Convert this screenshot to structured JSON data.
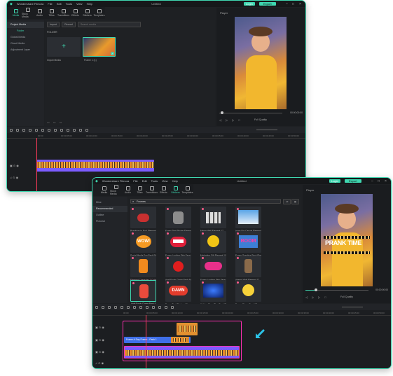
{
  "window1": {
    "app_name": "Wondershare Filmora",
    "menu": [
      "File",
      "Edit",
      "Tools",
      "View",
      "Help"
    ],
    "title": "Untitled",
    "login": "Login",
    "export": "Export",
    "tools": [
      "Media",
      "Stock Media",
      "Audio",
      "Titles",
      "Transitions",
      "Effects",
      "Stickers",
      "Templates"
    ],
    "sidebar": [
      "Project Media",
      "Folder",
      "Global Media",
      "Cloud Media",
      "Adjustment Layer"
    ],
    "import_btn": "Import",
    "record_btn": "Record",
    "search_placeholder": "Search media",
    "folder_label": "FOLDER",
    "import_media_label": "Import Media",
    "thumb_label": "Frame 1 (1)",
    "player_label": "Player",
    "time": "00:00:00:00",
    "quality": "Full Quality",
    "ruler": [
      "00:00",
      "00:00:05:00",
      "00:00:10:00",
      "00:00:15:00",
      "00:00:20:00",
      "00:00:25:00",
      "00:00:30:00",
      "00:00:35:00",
      "00:00:40:00",
      "00:00:45:00",
      "00:00:50:00"
    ]
  },
  "window2": {
    "app_name": "Wondershare Filmora",
    "menu": [
      "File",
      "Edit",
      "Tools",
      "View",
      "Help"
    ],
    "title": "Untitled",
    "login": "Login",
    "export": "Export",
    "tools": [
      "Media",
      "Stock Media",
      "Audio",
      "Titles",
      "Transitions",
      "Effects",
      "Stickers",
      "Templates"
    ],
    "sidebar": [
      "Mine",
      "Recommended",
      "Outline",
      "Pictorial"
    ],
    "search_value": "Frames",
    "player_label": "Player",
    "prank_text_1": "PRANK TIME",
    "time": "00:00:00:00",
    "quality": "Full Quality",
    "stickers": [
      {
        "caption": "Prankday in Fool Element 17",
        "art": "mouth"
      },
      {
        "caption": "Funny Text Sticker Element 5",
        "art": "cat"
      },
      {
        "caption": "Meme Wall Element 17",
        "art": "grid"
      },
      {
        "caption": "Icons For Casual Element 1",
        "art": "sky"
      },
      {
        "caption": "Social Media Fun Pack Elem...",
        "art": "wow"
      },
      {
        "caption": "Funny Looking Fish Face Ele...",
        "art": "teeth"
      },
      {
        "caption": "Marketing Gift Element 10",
        "art": "smiley"
      },
      {
        "caption": "Funny Graphics Pack Elem...",
        "art": "boom"
      },
      {
        "caption": "Element Character 2 Cubbe...",
        "art": "char"
      },
      {
        "caption": "April Fools Clown Pack Elem...",
        "art": "nose"
      },
      {
        "caption": "Funny Looking Fish Face Ele...",
        "art": "lips"
      },
      {
        "caption": "Absent Wolf Element 17",
        "art": "man"
      },
      {
        "caption": "April Fools Clown Pack Elem...",
        "art": "clown"
      },
      {
        "caption": "Funny Text Stickers Element...",
        "art": "damn"
      },
      {
        "caption": "Hidden Story Play Pack Ele...",
        "art": "curtain"
      },
      {
        "caption": "Funny Clown Emoji Element...",
        "art": "emoji"
      }
    ],
    "clip_label": "Frame A Day Frame - Pack 1",
    "ruler": [
      "00:00",
      "00:00:05:00",
      "00:00:10:00",
      "00:00:15:00",
      "00:00:20:00",
      "00:00:25:00",
      "00:00:30:00",
      "00:00:35:00",
      "00:00:40:00",
      "00:00:45:00",
      "00:00:50:00"
    ]
  },
  "colors": {
    "accent": "#3fd7b0",
    "playhead": "#ff3b5c",
    "clip_purple": "#7c5cff",
    "highlight_pink": "#ff2fb3",
    "arrow": "#2bc3e8"
  }
}
